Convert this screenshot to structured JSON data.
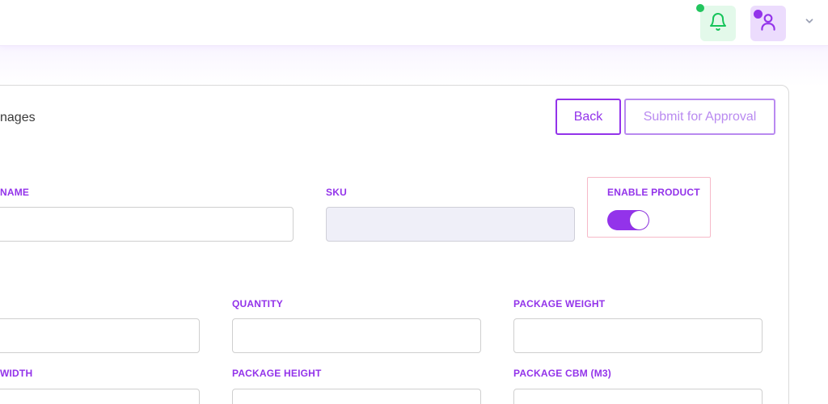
{
  "header": {
    "notifications_icon": "bell-icon",
    "user_icon": "user-icon",
    "menu_icon": "chevron-down-icon"
  },
  "card": {
    "title": "nages",
    "back_label": "Back",
    "submit_label": "Submit for Approval"
  },
  "form": {
    "name_label": "NAME",
    "name_value": "",
    "sku_label": "SKU",
    "sku_value": "",
    "enable_label": "ENABLE PRODUCT",
    "enabled": true,
    "quantity_label": "QUANTITY",
    "package_weight_label": "PACKAGE WEIGHT",
    "width_label": "WIDTH",
    "package_height_label": "PACKAGE HEIGHT",
    "package_cbm_label": "PACKAGE CBM (M3)"
  },
  "colors": {
    "accent": "#9333ea",
    "notification_green": "#22c55e"
  }
}
